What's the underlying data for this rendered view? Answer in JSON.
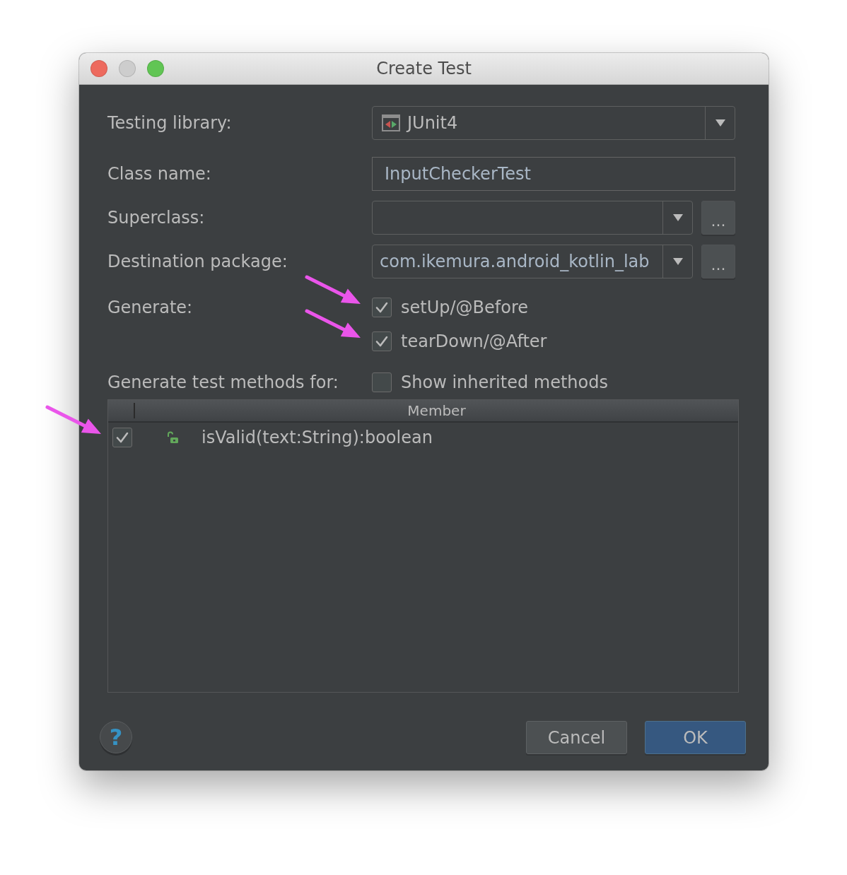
{
  "window": {
    "title": "Create Test",
    "buttons": [
      {
        "kind": "close",
        "disabled": false
      },
      {
        "kind": "minimize",
        "disabled": true
      },
      {
        "kind": "zoom",
        "disabled": false
      }
    ]
  },
  "form": {
    "testing_library": {
      "label": "Testing library:",
      "value": "JUnit4"
    },
    "class_name": {
      "label": "Class name:",
      "value": "InputCheckerTest"
    },
    "superclass": {
      "label": "Superclass:",
      "browse": "..."
    },
    "destination_package": {
      "label": "Destination package:",
      "value": "com.ikemura.android_kotlin_lab",
      "browse": "..."
    },
    "generate": {
      "label": "Generate:",
      "options": [
        {
          "label": "setUp/@Before",
          "checked": true,
          "annotated": true
        },
        {
          "label": "tearDown/@After",
          "checked": true,
          "annotated": true
        }
      ]
    },
    "methods": {
      "label": "Generate test methods for:",
      "show_inherited": {
        "label": "Show inherited methods",
        "checked": false
      }
    }
  },
  "members_table": {
    "column": "Member",
    "rows": [
      {
        "name": "isValid(text:String):boolean",
        "checked": true,
        "annotated": true
      }
    ]
  },
  "help": {
    "label": "?"
  },
  "buttons": [
    {
      "label": "Cancel",
      "kind": "secondary"
    },
    {
      "label": "OK",
      "kind": "default"
    }
  ]
}
